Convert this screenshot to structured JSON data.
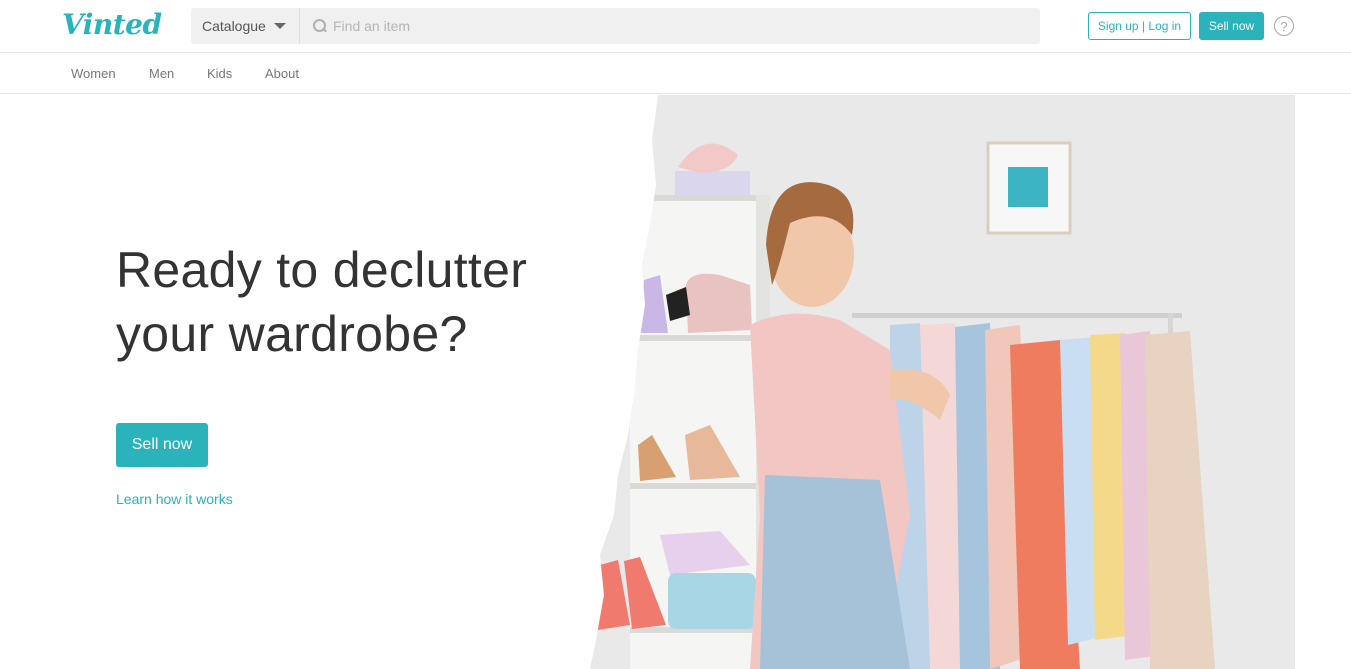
{
  "header": {
    "logo": "Vinted",
    "catalogue_label": "Catalogue",
    "search_placeholder": "Find an item",
    "signup_login_label": "Sign up | Log in",
    "sell_now_label": "Sell now",
    "help_glyph": "?"
  },
  "nav": {
    "items": [
      {
        "label": "Women"
      },
      {
        "label": "Men"
      },
      {
        "label": "Kids"
      },
      {
        "label": "About"
      }
    ]
  },
  "hero": {
    "title_line1": "Ready to declutter",
    "title_line2": "your wardrobe?",
    "cta_label": "Sell now",
    "link_label": "Learn how it works",
    "image_icon": "woman-with-clothes-rack-photo"
  },
  "colors": {
    "accent": "#2ab3ba",
    "text": "#333333"
  }
}
